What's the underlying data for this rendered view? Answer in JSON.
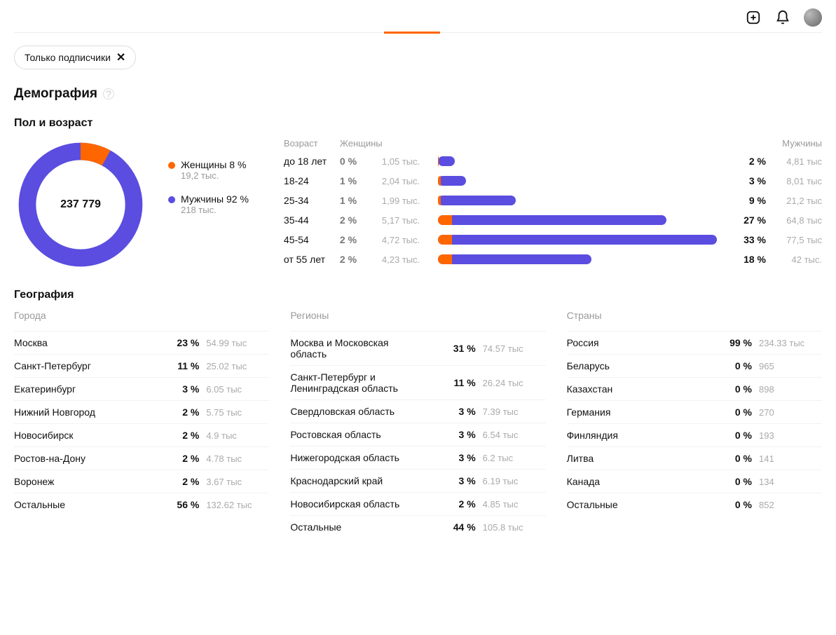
{
  "chip": {
    "label": "Только подписчики"
  },
  "section": {
    "demography": "Демография",
    "gender_age": "Пол и возраст",
    "geography": "География"
  },
  "donut": {
    "total": "237 779"
  },
  "genders": [
    {
      "label": "Женщины 8 %",
      "count": "19,2 тыс.",
      "color": "#ff6600"
    },
    {
      "label": "Мужчины 92 %",
      "count": "218 тыс.",
      "color": "#5a4de0"
    }
  ],
  "age_head": {
    "age": "Возраст",
    "women": "Женщины",
    "men": "Мужчины"
  },
  "age_rows": [
    {
      "label": "до 18 лет",
      "w_pct": "0 %",
      "w_cnt": "1,05 тыс.",
      "m_pct": "2 %",
      "m_cnt": "4,81 тыс",
      "m_bar": 6,
      "f_bar": 0.4
    },
    {
      "label": "18-24",
      "w_pct": "1 %",
      "w_cnt": "2,04 тыс.",
      "m_pct": "3 %",
      "m_cnt": "8,01 тыс",
      "m_bar": 10,
      "f_bar": 1
    },
    {
      "label": "25-34",
      "w_pct": "1 %",
      "w_cnt": "1,99 тыс.",
      "m_pct": "9 %",
      "m_cnt": "21,2 тыс",
      "m_bar": 28,
      "f_bar": 1
    },
    {
      "label": "35-44",
      "w_pct": "2 %",
      "w_cnt": "5,17 тыс.",
      "m_pct": "27 %",
      "m_cnt": "64,8 тыс",
      "m_bar": 82,
      "f_bar": 5
    },
    {
      "label": "45-54",
      "w_pct": "2 %",
      "w_cnt": "4,72 тыс.",
      "m_pct": "33 %",
      "m_cnt": "77,5 тыс",
      "m_bar": 100,
      "f_bar": 5
    },
    {
      "label": "от 55 лет",
      "w_pct": "2 %",
      "w_cnt": "4,23 тыс.",
      "m_pct": "18 %",
      "m_cnt": "42 тыс.",
      "m_bar": 55,
      "f_bar": 5
    }
  ],
  "geo": {
    "cities_title": "Города",
    "regions_title": "Регионы",
    "countries_title": "Страны",
    "cities": [
      {
        "name": "Москва",
        "pct": "23 %",
        "cnt": "54.99 тыс"
      },
      {
        "name": "Санкт-Петербург",
        "pct": "11 %",
        "cnt": "25.02 тыс"
      },
      {
        "name": "Екатеринбург",
        "pct": "3 %",
        "cnt": "6.05 тыс"
      },
      {
        "name": "Нижний Новгород",
        "pct": "2 %",
        "cnt": "5.75 тыс"
      },
      {
        "name": "Новосибирск",
        "pct": "2 %",
        "cnt": "4.9 тыс"
      },
      {
        "name": "Ростов-на-Дону",
        "pct": "2 %",
        "cnt": "4.78 тыс"
      },
      {
        "name": "Воронеж",
        "pct": "2 %",
        "cnt": "3.67 тыс"
      },
      {
        "name": "Остальные",
        "pct": "56 %",
        "cnt": "132.62 тыс"
      }
    ],
    "regions": [
      {
        "name": "Москва и Московская область",
        "pct": "31 %",
        "cnt": "74.57 тыс"
      },
      {
        "name": "Санкт-Петербург и Ленинградская область",
        "pct": "11 %",
        "cnt": "26.24 тыс"
      },
      {
        "name": "Свердловская область",
        "pct": "3 %",
        "cnt": "7.39 тыс"
      },
      {
        "name": "Ростовская область",
        "pct": "3 %",
        "cnt": "6.54 тыс"
      },
      {
        "name": "Нижегородская область",
        "pct": "3 %",
        "cnt": "6.2 тыс"
      },
      {
        "name": "Краснодарский край",
        "pct": "3 %",
        "cnt": "6.19 тыс"
      },
      {
        "name": "Новосибирская область",
        "pct": "2 %",
        "cnt": "4.85 тыс"
      },
      {
        "name": "Остальные",
        "pct": "44 %",
        "cnt": "105.8 тыс"
      }
    ],
    "countries": [
      {
        "name": "Россия",
        "pct": "99 %",
        "cnt": "234.33 тыс"
      },
      {
        "name": "Беларусь",
        "pct": "0 %",
        "cnt": "965"
      },
      {
        "name": "Казахстан",
        "pct": "0 %",
        "cnt": "898"
      },
      {
        "name": "Германия",
        "pct": "0 %",
        "cnt": "270"
      },
      {
        "name": "Финляндия",
        "pct": "0 %",
        "cnt": "193"
      },
      {
        "name": "Литва",
        "pct": "0 %",
        "cnt": "141"
      },
      {
        "name": "Канада",
        "pct": "0 %",
        "cnt": "134"
      },
      {
        "name": "Остальные",
        "pct": "0 %",
        "cnt": "852"
      }
    ]
  },
  "chart_data": {
    "type": "bar",
    "title": "Демография — Пол и возраст",
    "donut": {
      "total": 237779,
      "series": [
        {
          "name": "Женщины",
          "percent": 8,
          "count_label": "19,2 тыс."
        },
        {
          "name": "Мужчины",
          "percent": 92,
          "count_label": "218 тыс."
        }
      ]
    },
    "age": {
      "categories": [
        "до 18 лет",
        "18-24",
        "25-34",
        "35-44",
        "45-54",
        "от 55 лет"
      ],
      "series": [
        {
          "name": "Женщины",
          "percent": [
            0,
            1,
            1,
            2,
            2,
            2
          ],
          "count_label": [
            "1,05 тыс.",
            "2,04 тыс.",
            "1,99 тыс.",
            "5,17 тыс.",
            "4,72 тыс.",
            "4,23 тыс."
          ]
        },
        {
          "name": "Мужчины",
          "percent": [
            2,
            3,
            9,
            27,
            33,
            18
          ],
          "count_label": [
            "4,81 тыс",
            "8,01 тыс",
            "21,2 тыс",
            "64,8 тыс",
            "77,5 тыс",
            "42 тыс."
          ]
        }
      ]
    }
  }
}
